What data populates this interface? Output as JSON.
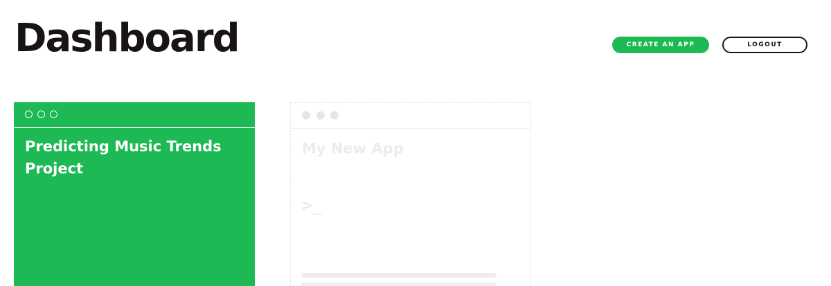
{
  "header": {
    "title": "Dashboard",
    "create_label": "CREATE AN APP",
    "logout_label": "LOGOUT"
  },
  "apps": [
    {
      "name": "Predicting Music Trends Project"
    }
  ],
  "new_app": {
    "title": "My New App",
    "prompt": ">_"
  },
  "colors": {
    "brand": "#1db954",
    "text": "#191414",
    "placeholder": "#e6e6e6"
  }
}
